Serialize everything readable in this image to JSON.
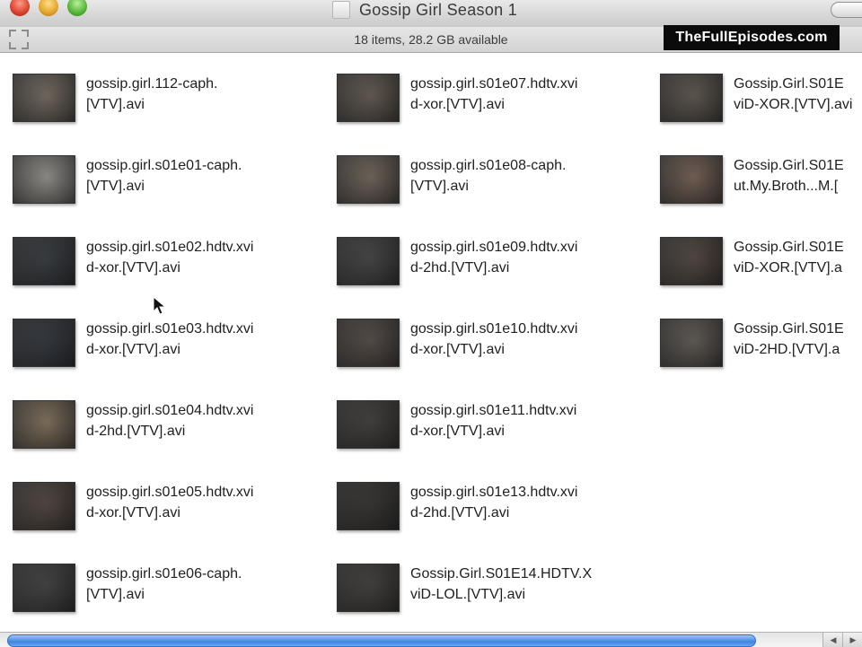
{
  "window": {
    "title": "Gossip Girl Season 1"
  },
  "status": {
    "text": "18 items, 28.2 GB available"
  },
  "watermark": {
    "text": "TheFullEpisodes.com"
  },
  "files": [
    {
      "line1": "gossip.girl.112-caph.",
      "line2": "[VTV].avi",
      "tone": "#6e655a"
    },
    {
      "line1": "gossip.girl.s01e01-caph.",
      "line2": "[VTV].avi",
      "tone": "#8d8b86"
    },
    {
      "line1": "gossip.girl.s01e02.hdtv.xvi",
      "line2": "d-xor.[VTV].avi",
      "tone": "#2f3338"
    },
    {
      "line1": "gossip.girl.s01e03.hdtv.xvi",
      "line2": "d-xor.[VTV].avi",
      "tone": "#2b2f36"
    },
    {
      "line1": "gossip.girl.s01e04.hdtv.xvi",
      "line2": "d-2hd.[VTV].avi",
      "tone": "#7a6a55"
    },
    {
      "line1": "gossip.girl.s01e05.hdtv.xvi",
      "line2": "d-xor.[VTV].avi",
      "tone": "#4a3f38"
    },
    {
      "line1": "gossip.girl.s01e06-caph.",
      "line2": "[VTV].avi",
      "tone": "#3a3a3a"
    },
    {
      "line1": "gossip.girl.s01e07.hdtv.xvi",
      "line2": "d-xor.[VTV].avi",
      "tone": "#5d544b"
    },
    {
      "line1": "gossip.girl.s01e08-caph.",
      "line2": "[VTV].avi",
      "tone": "#6b6055"
    },
    {
      "line1": "gossip.girl.s01e09.hdtv.xvi",
      "line2": "d-2hd.[VTV].avi",
      "tone": "#3d3d3d"
    },
    {
      "line1": "gossip.girl.s01e10.hdtv.xvi",
      "line2": "d-xor.[VTV].avi",
      "tone": "#4d4540"
    },
    {
      "line1": "gossip.girl.s01e11.hdtv.xvi",
      "line2": "d-xor.[VTV].avi",
      "tone": "#3a3734"
    },
    {
      "line1": "gossip.girl.s01e13.hdtv.xvi",
      "line2": "d-2hd.[VTV].avi",
      "tone": "#2e2c2a"
    },
    {
      "line1": "Gossip.Girl.S01E14.HDTV.X",
      "line2": "viD-LOL.[VTV].avi",
      "tone": "#3a3734"
    },
    {
      "line1": "Gossip.Girl.S01E",
      "line2": "viD-XOR.[VTV].avi",
      "tone": "#585048"
    },
    {
      "line1": "Gossip.Girl.S01E",
      "line2": "ut.My.Broth...M.[",
      "tone": "#6e5a4e"
    },
    {
      "line1": "Gossip.Girl.S01E",
      "line2": "viD-XOR.[VTV].a",
      "tone": "#4a4038"
    },
    {
      "line1": "Gossip.Girl.S01E",
      "line2": "viD-2HD.[VTV].a",
      "tone": "#5a544e"
    }
  ],
  "icons": {
    "close": "close-button-icon",
    "minimize": "minimize-button-icon",
    "zoom": "zoom-button-icon",
    "folder": "folder-icon",
    "resize": "fullscreen-resize-icon",
    "pointer": "mouse-pointer-icon",
    "scroll_left": "scroll-left-arrow-icon",
    "scroll_right": "scroll-right-arrow-icon"
  },
  "colors": {
    "scroll_thumb": "#3e86e0",
    "watermark_bg": "#0b0b0b"
  }
}
